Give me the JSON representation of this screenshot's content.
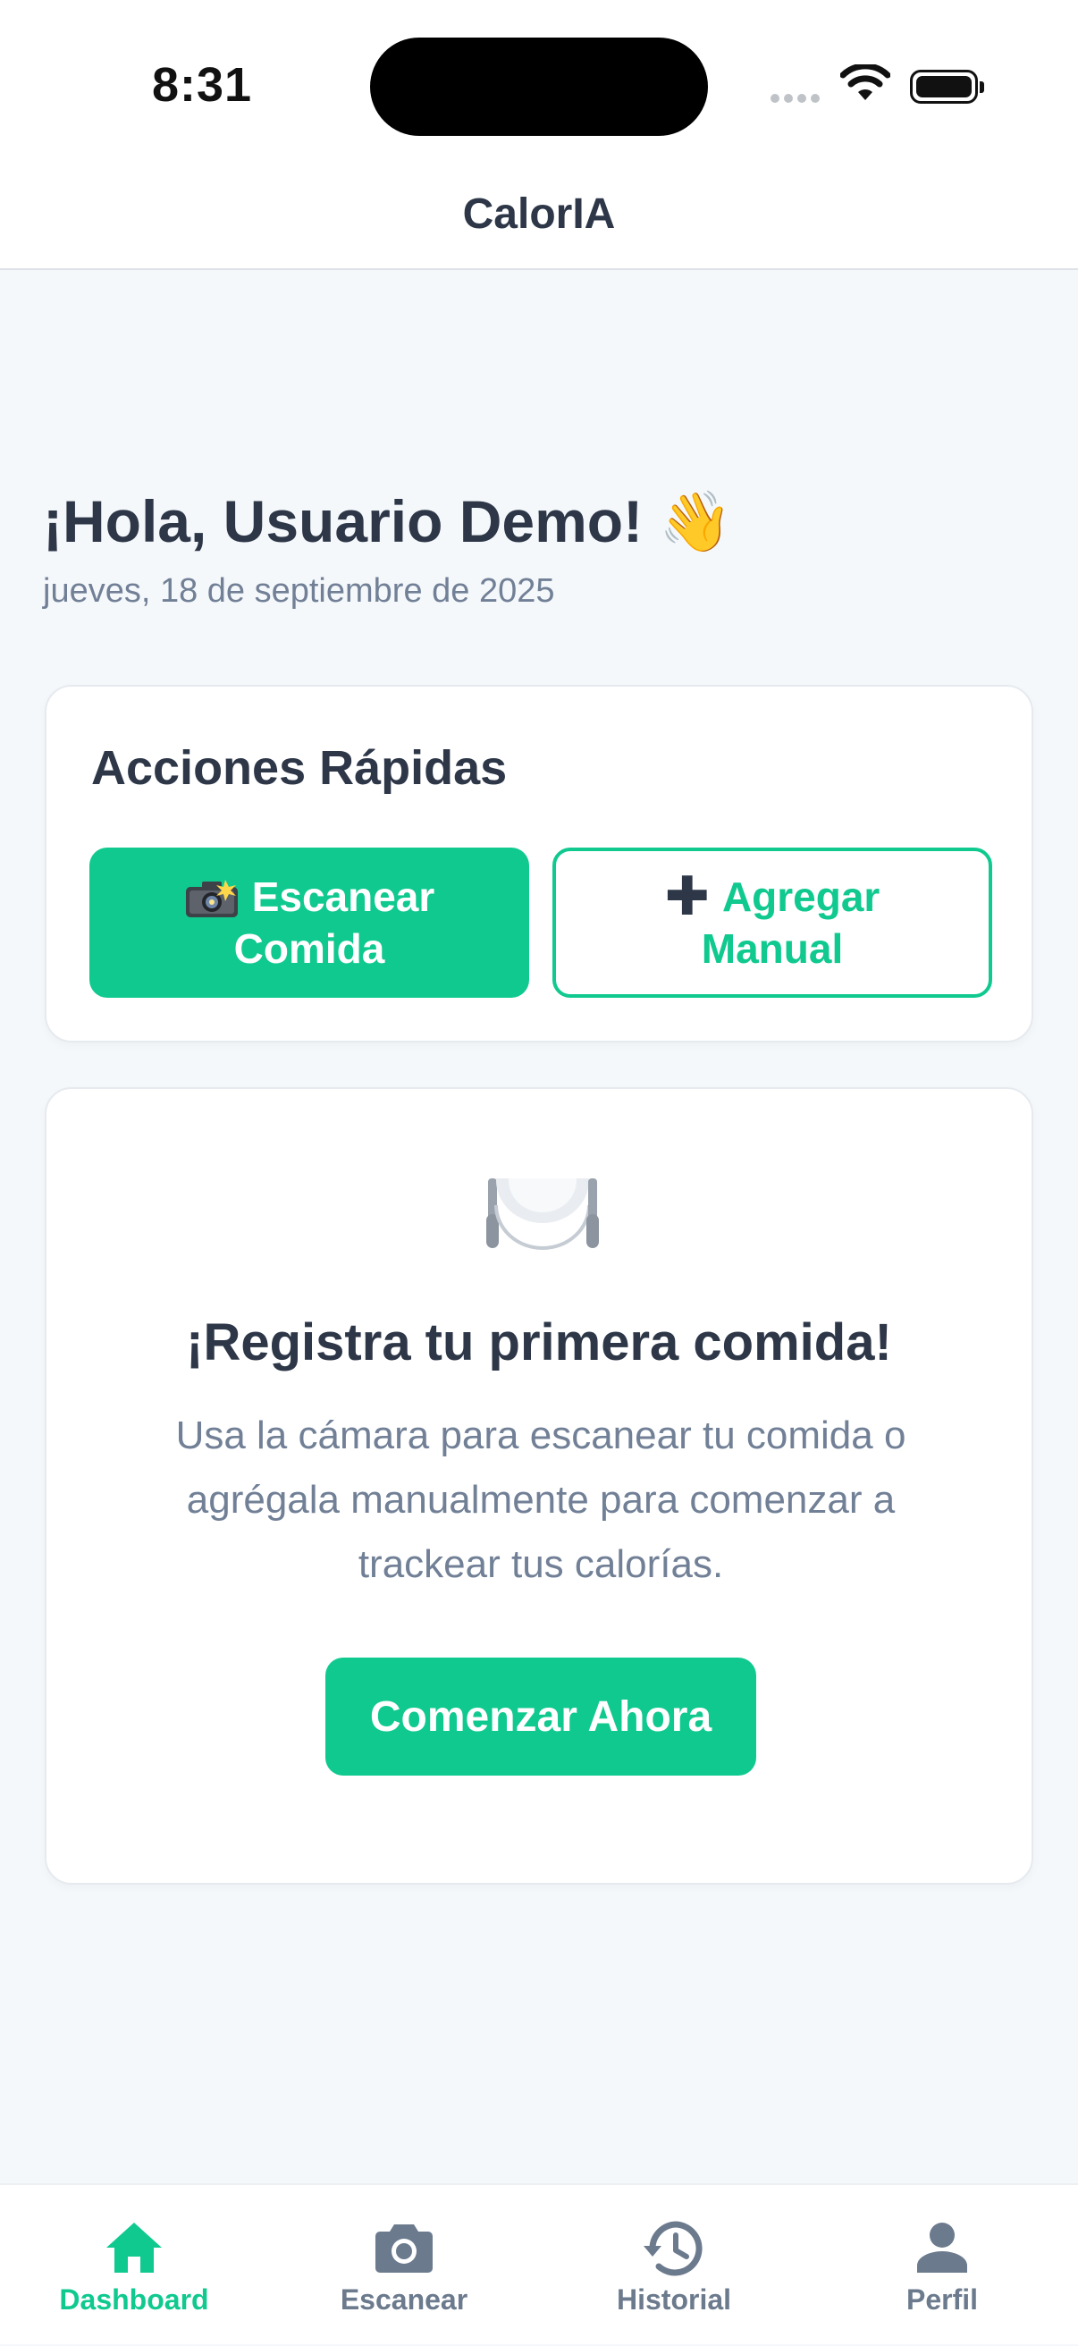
{
  "status": {
    "time": "8:31"
  },
  "header": {
    "title": "CalorIA"
  },
  "greeting": {
    "text": "¡Hola, Usuario Demo! 👋",
    "date": "jueves, 18 de septiembre de 2025"
  },
  "quick_actions": {
    "title": "Acciones Rápidas",
    "scan_line1": "Escanear",
    "scan_line2": "Comida",
    "manual_line1": "Agregar",
    "manual_line2": "Manual"
  },
  "empty_state": {
    "title": "¡Registra tu primera comida!",
    "body": "Usa la cámara para escanear tu comida o agrégala manualmente para comenzar a trackear tus calorías.",
    "cta": "Comenzar Ahora"
  },
  "tabs": [
    {
      "label": "Dashboard",
      "icon": "home-icon",
      "active": true
    },
    {
      "label": "Escanear",
      "icon": "camera-icon",
      "active": false
    },
    {
      "label": "Historial",
      "icon": "history-icon",
      "active": false
    },
    {
      "label": "Perfil",
      "icon": "person-icon",
      "active": false
    }
  ],
  "colors": {
    "accent": "#10c98f",
    "text": "#2d3748",
    "muted": "#718096",
    "background": "#f5f8fb"
  }
}
